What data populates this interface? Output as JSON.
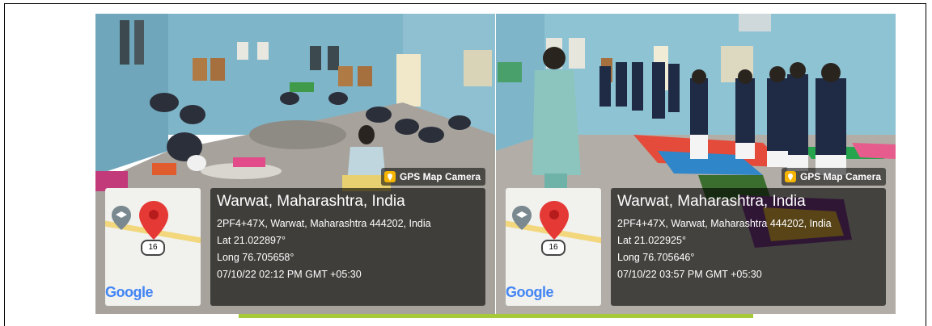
{
  "photos": [
    {
      "badge": "GPS Map Camera",
      "map_logo": "Google",
      "location_title": "Warwat, Maharashtra, India",
      "address": "2PF4+47X, Warwat, Maharashtra 444202, India",
      "lat": "Lat 21.022897°",
      "long": "Long 76.705658°",
      "datetime": "07/10/22 02:12 PM GMT +05:30"
    },
    {
      "badge": "GPS Map Camera",
      "map_logo": "Google",
      "location_title": "Warwat, Maharashtra, India",
      "address": "2PF4+47X, Warwat, Maharashtra 444202, India",
      "lat": "Lat 21.022925°",
      "long": "Long 76.705646°",
      "datetime": "07/10/22 03:57 PM GMT +05:30"
    }
  ],
  "colors": {
    "wall": "#7fb5c9",
    "floor": "#a7a39c",
    "accent_bar": "#a6c93a",
    "map_pin": "#e53935"
  }
}
